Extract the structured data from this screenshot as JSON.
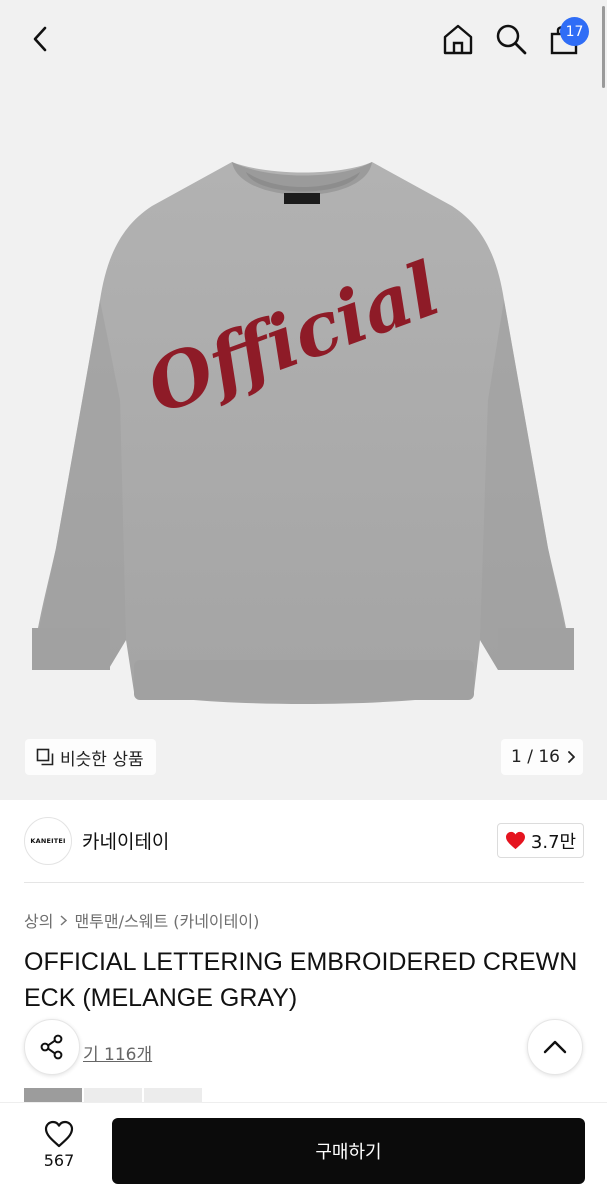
{
  "header": {
    "back_icon": "chevron-left-icon",
    "home_icon": "home-icon",
    "search_icon": "search-icon",
    "cart_icon": "shopping-bag-icon",
    "cart_count": "17",
    "badge_color": "#2f6df6"
  },
  "product_image": {
    "print_text": "Official",
    "print_color": "#8e1b27",
    "garment_color": "#a9a9a9",
    "similar_label": "비슷한 상품",
    "page_indicator": "1 / 16"
  },
  "brand": {
    "logo_text": "KANEITEI",
    "name": "카네이테이",
    "likes": "3.7만",
    "heart_color": "#e5141f"
  },
  "breadcrumb": {
    "level1": "상의",
    "level2": "맨투맨/스웨트 (카네이테이)"
  },
  "product": {
    "title": "OFFICIAL LETTERING EMBROIDERED CREWNECK (MELANGE GRAY)",
    "review_label": "기 116개"
  },
  "bottom_bar": {
    "wish_count": "567",
    "buy_label": "구매하기"
  }
}
